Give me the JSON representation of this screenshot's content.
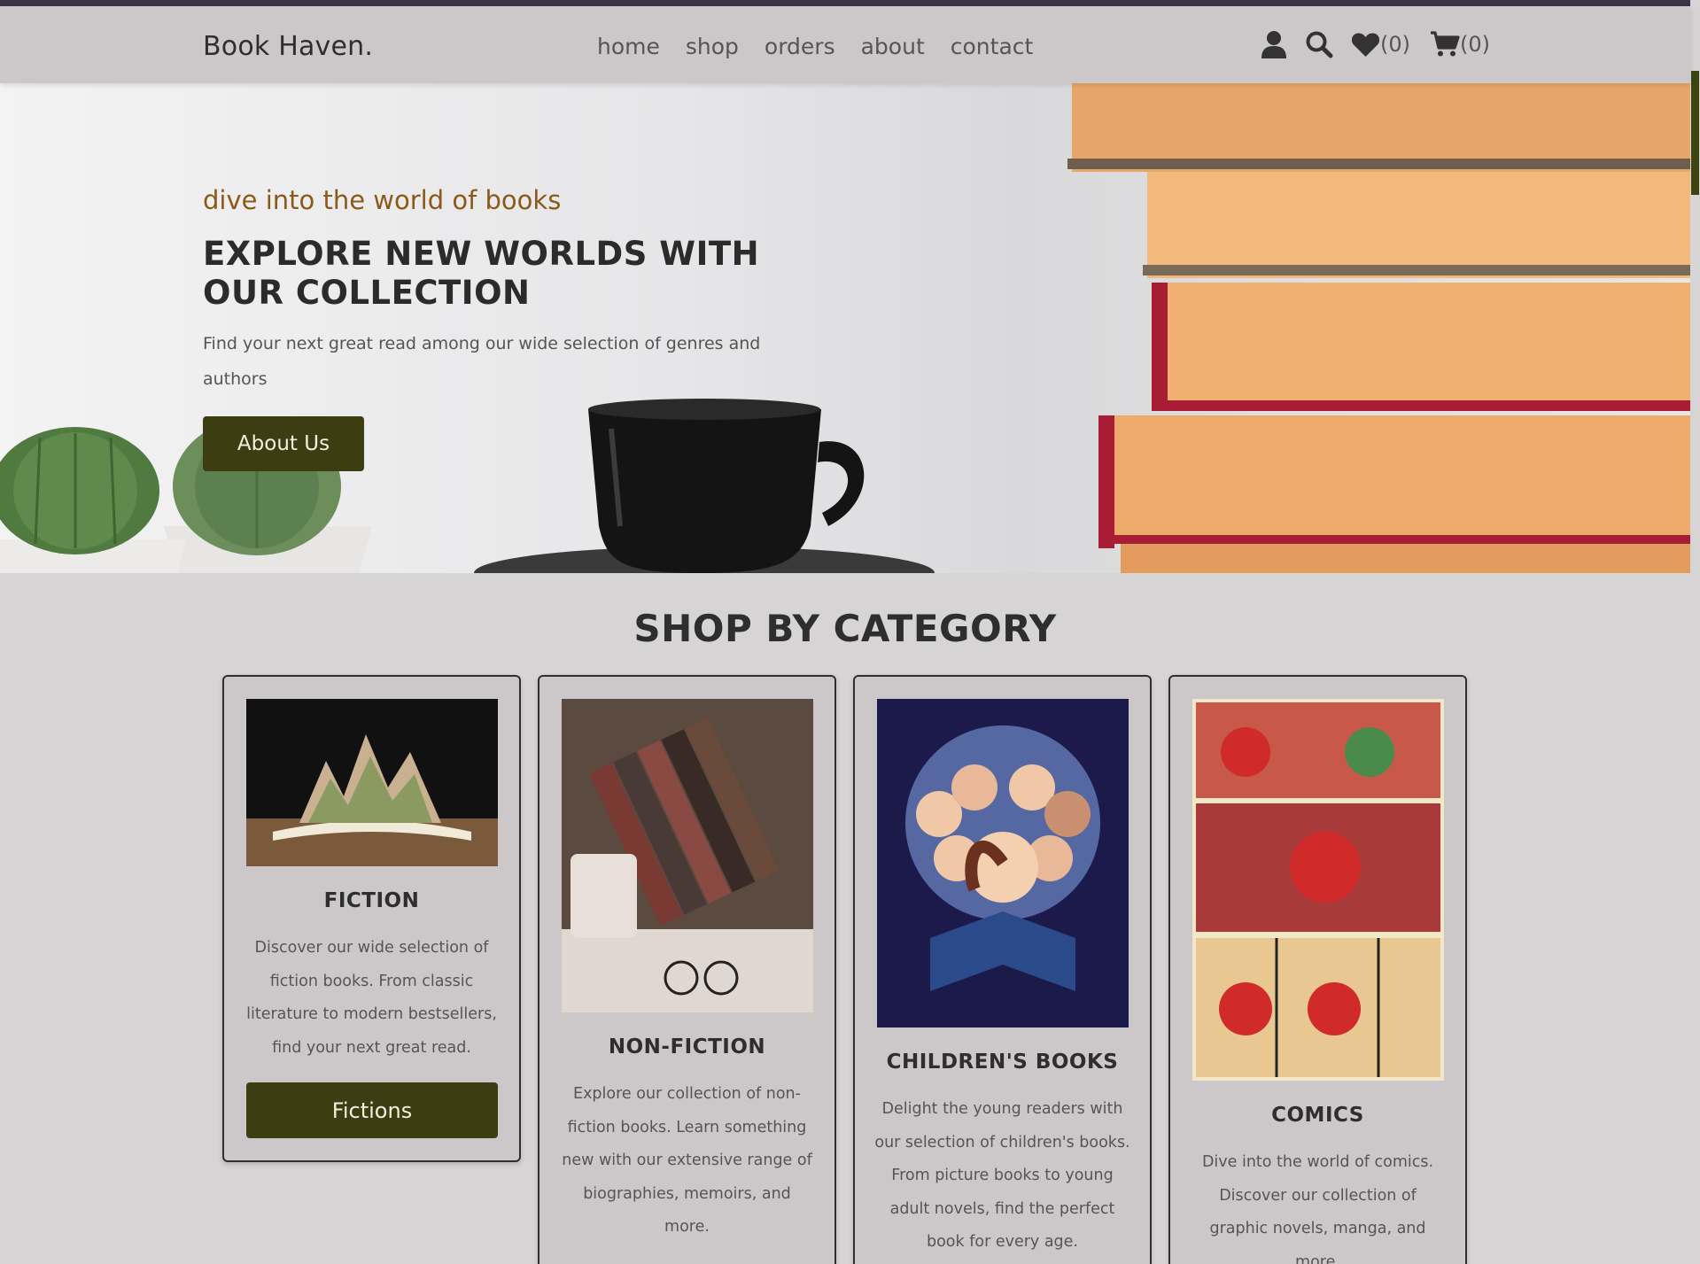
{
  "header": {
    "logo": "Book Haven.",
    "nav": [
      "home",
      "shop",
      "orders",
      "about",
      "contact"
    ],
    "icons": [
      "user-icon",
      "search-icon",
      "heart-icon",
      "cart-icon"
    ],
    "wishlist_count": "(0)",
    "cart_count": "(0)"
  },
  "hero": {
    "tagline": "dive into the world of books",
    "title": "EXPLORE NEW WORLDS WITH OUR COLLECTION",
    "description": "Find your next great read among our wide selection of genres and authors",
    "button_label": "About Us"
  },
  "categories": {
    "title": "SHOP BY CATEGORY",
    "items": [
      {
        "title": "FICTION",
        "description": "Discover our wide selection of fiction books. From classic literature to modern bestsellers, find your next great read.",
        "button_label": "Fictions"
      },
      {
        "title": "NON-FICTION",
        "description": "Explore our collection of non-fiction books. Learn something new with our extensive range of biographies, memoirs, and more."
      },
      {
        "title": "CHILDREN'S BOOKS",
        "description": "Delight the young readers with our selection of children's books. From picture books to young adult novels, find the perfect book for every age."
      },
      {
        "title": "COMICS",
        "description": "Dive into the world of comics. Discover our collection of graphic novels, manga, and more."
      }
    ]
  },
  "colors": {
    "header_bg": "#ccc8c9",
    "page_bg": "#d6d4d5",
    "button_bg": "#3d3d12",
    "tagline": "#8b5a1a",
    "top_strip": "#3b3348"
  }
}
